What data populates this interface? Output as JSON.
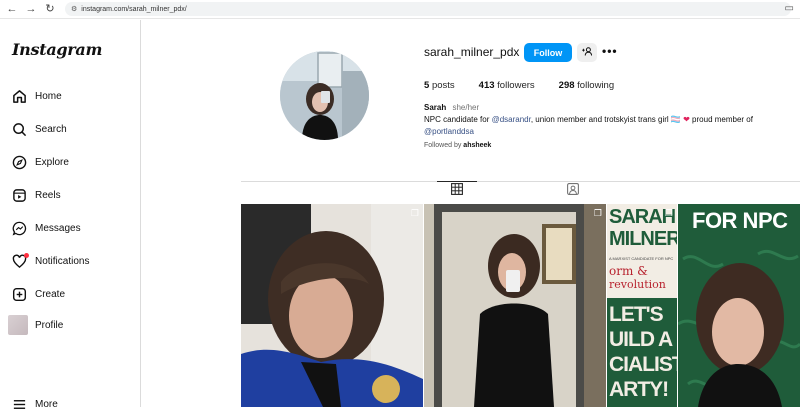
{
  "browser": {
    "url": "instagram.com/sarah_milner_pdx/"
  },
  "sidebar": {
    "logo": "Instagram",
    "items": [
      {
        "label": "Home",
        "icon": "home-icon"
      },
      {
        "label": "Search",
        "icon": "search-icon"
      },
      {
        "label": "Explore",
        "icon": "explore-icon"
      },
      {
        "label": "Reels",
        "icon": "reels-icon"
      },
      {
        "label": "Messages",
        "icon": "messages-icon"
      },
      {
        "label": "Notifications",
        "icon": "heart-icon"
      },
      {
        "label": "Create",
        "icon": "plus-icon"
      },
      {
        "label": "Profile",
        "icon": "avatar"
      },
      {
        "label": "More",
        "icon": "menu-icon"
      }
    ]
  },
  "profile": {
    "username": "sarah_milner_pdx",
    "follow_label": "Follow",
    "posts_count": "5",
    "posts_label": "posts",
    "followers_count": "413",
    "followers_label": "followers",
    "following_count": "298",
    "following_label": "following",
    "name": "Sarah",
    "pronouns": "she/her",
    "bio_prefix": "NPC candidate for ",
    "bio_mention": "@dsarandr",
    "bio_middle": ", union member and trotskyist trans girl ",
    "bio_flag": "🏳️‍⚧️",
    "bio_heart": "❤",
    "bio_suffix": " proud member of",
    "bio_link": "@portlanddsa",
    "followed_by_prefix": "Followed by ",
    "followed_by_user": "ahsheek"
  },
  "tiles": [
    {
      "caption": ""
    },
    {
      "caption": ""
    },
    {
      "poster_lines": [
        "SARAH",
        "MILNER"
      ],
      "poster_sub": "A MARXIST CANDIDATE FOR NPC",
      "poster_mid": "orm &",
      "poster_red": "revolution",
      "poster_bottom": [
        "LET'S",
        "UILD A",
        "CIALIST",
        "ARTY!"
      ]
    },
    {
      "poster_top": "FOR NPC"
    }
  ],
  "colors": {
    "accent": "#0095f6",
    "poster_green": "#1f5c3a",
    "poster_red": "#b8232f"
  }
}
